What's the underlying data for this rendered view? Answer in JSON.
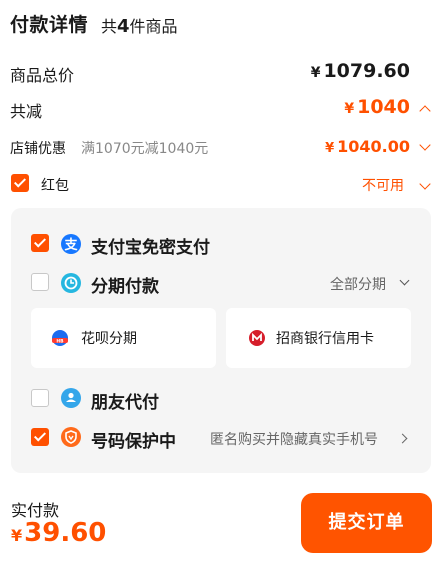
{
  "header": {
    "title": "付款详情",
    "count_prefix": "共",
    "count_value": "4",
    "count_suffix": "件商品"
  },
  "rows": {
    "total": {
      "label": "商品总价",
      "currency": "¥",
      "amount": "1079.60"
    },
    "discount": {
      "label": "共减",
      "currency": "¥",
      "amount": "1040"
    },
    "store": {
      "label": "店铺优惠",
      "note": "满1070元减1040元",
      "currency": "¥",
      "amount": "1040.00"
    },
    "redpacket": {
      "label": "红包",
      "status": "不可用",
      "checked": true
    }
  },
  "payment": {
    "alipay": {
      "label": "支付宝免密支付",
      "checked": true,
      "icon": "alipay-icon"
    },
    "installment": {
      "label": "分期付款",
      "checked": false,
      "icon": "installment-icon",
      "option": "全部分期",
      "cards": [
        {
          "label": "花呗分期",
          "icon": "huabei-icon"
        },
        {
          "label": "招商银行信用卡",
          "icon": "cmb-bank-icon"
        }
      ]
    },
    "friend": {
      "label": "朋友代付",
      "checked": false,
      "icon": "friend-pay-icon"
    },
    "privacy": {
      "label": "号码保护中",
      "checked": true,
      "icon": "privacy-shield-icon",
      "note": "匿名购买并隐藏真实手机号"
    }
  },
  "footer": {
    "label": "实付款",
    "currency": "¥",
    "amount": "39.60",
    "submit_label": "提交订单"
  },
  "colors": {
    "accent": "#ff5000",
    "panel_bg": "#f5f5f5",
    "alipay": "#1677ff",
    "installment": "#26b7e0",
    "cmb": "#d61e2b"
  }
}
